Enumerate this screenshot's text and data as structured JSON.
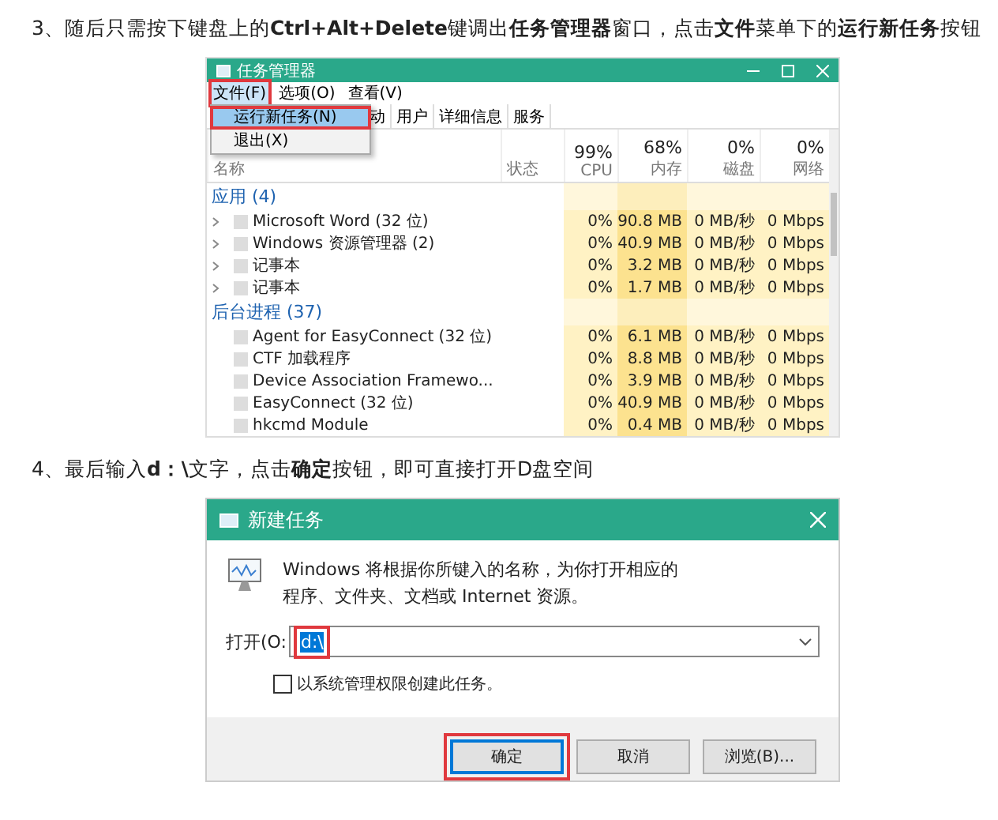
{
  "step_3": {
    "text": "3、随后只需按下键盘上的**Ctrl+Alt+Delete**键调出**任务管理器**窗口，点击**文件**菜单下的**运行新任务**按钮",
    "task_manager": {
      "title": "任务管理器",
      "menu": [
        {
          "label": "文件(F)",
          "selected": true,
          "annotated": true
        },
        {
          "label": "选项(O)",
          "selected": false,
          "annotated": false
        },
        {
          "label": "查看(V)",
          "selected": false,
          "annotated": false
        }
      ],
      "dropdown": [
        {
          "label": "运行新任务(N)",
          "selected": true,
          "annotated": true
        },
        {
          "label": "退出(X)",
          "selected": false,
          "annotated": false
        }
      ],
      "tabs": [
        "动",
        "用户",
        "详细信息",
        "服务"
      ],
      "columns": [
        {
          "label": "名称"
        },
        {
          "label": "状态"
        },
        {
          "percent": "99%",
          "label": "CPU"
        },
        {
          "percent": "68%",
          "label": "内存"
        },
        {
          "percent": "0%",
          "label": "磁盘"
        },
        {
          "percent": "0%",
          "label": "网络"
        }
      ],
      "groups": [
        {
          "title": "应用 (4)",
          "rows": [
            {
              "name": "Microsoft Word (32 位)",
              "expandable": true,
              "cpu": "0%",
              "memory": "90.8 MB",
              "disk": "0 MB/秒",
              "network": "0 Mbps"
            },
            {
              "name": "Windows 资源管理器 (2)",
              "expandable": true,
              "cpu": "0%",
              "memory": "40.9 MB",
              "disk": "0 MB/秒",
              "network": "0 Mbps"
            },
            {
              "name": "记事本",
              "expandable": true,
              "cpu": "0%",
              "memory": "3.2 MB",
              "disk": "0 MB/秒",
              "network": "0 Mbps"
            },
            {
              "name": "记事本",
              "expandable": true,
              "cpu": "0%",
              "memory": "1.7 MB",
              "disk": "0 MB/秒",
              "network": "0 Mbps"
            }
          ]
        },
        {
          "title": "后台进程 (37)",
          "rows": [
            {
              "name": "Agent for EasyConnect (32 位)",
              "expandable": false,
              "cpu": "0%",
              "memory": "6.1 MB",
              "disk": "0 MB/秒",
              "network": "0 Mbps"
            },
            {
              "name": "CTF 加载程序",
              "expandable": false,
              "cpu": "0%",
              "memory": "8.8 MB",
              "disk": "0 MB/秒",
              "network": "0 Mbps"
            },
            {
              "name": "Device Association Framewo...",
              "expandable": false,
              "cpu": "0%",
              "memory": "3.9 MB",
              "disk": "0 MB/秒",
              "network": "0 Mbps"
            },
            {
              "name": "EasyConnect (32 位)",
              "expandable": false,
              "cpu": "0%",
              "memory": "40.9 MB",
              "disk": "0 MB/秒",
              "network": "0 Mbps"
            },
            {
              "name": "hkcmd Module",
              "expandable": false,
              "cpu": "0%",
              "memory": "0.4 MB",
              "disk": "0 MB/秒",
              "network": "0 Mbps"
            }
          ]
        }
      ]
    }
  },
  "step_4": {
    "text": "4、最后输入**d：\\**文字，点击**确定**按钮，即可直接打开D盘空间",
    "run_dialog": {
      "title": "新建任务",
      "description": "Windows 将根据你所键入的名称，为你打开相应的程序、文件夹、文档或 Internet 资源。",
      "open_label": "打开(O:",
      "input": {
        "value": "d:\\",
        "annotated": true
      },
      "checkbox": {
        "label": "以系统管理权限创建此任务。",
        "checked": false
      },
      "buttons": [
        {
          "label": "确定",
          "default": true,
          "annotated": true
        },
        {
          "label": "取消",
          "default": false,
          "annotated": false
        },
        {
          "label": "浏览(B)...",
          "default": false,
          "annotated": false
        }
      ]
    }
  }
}
